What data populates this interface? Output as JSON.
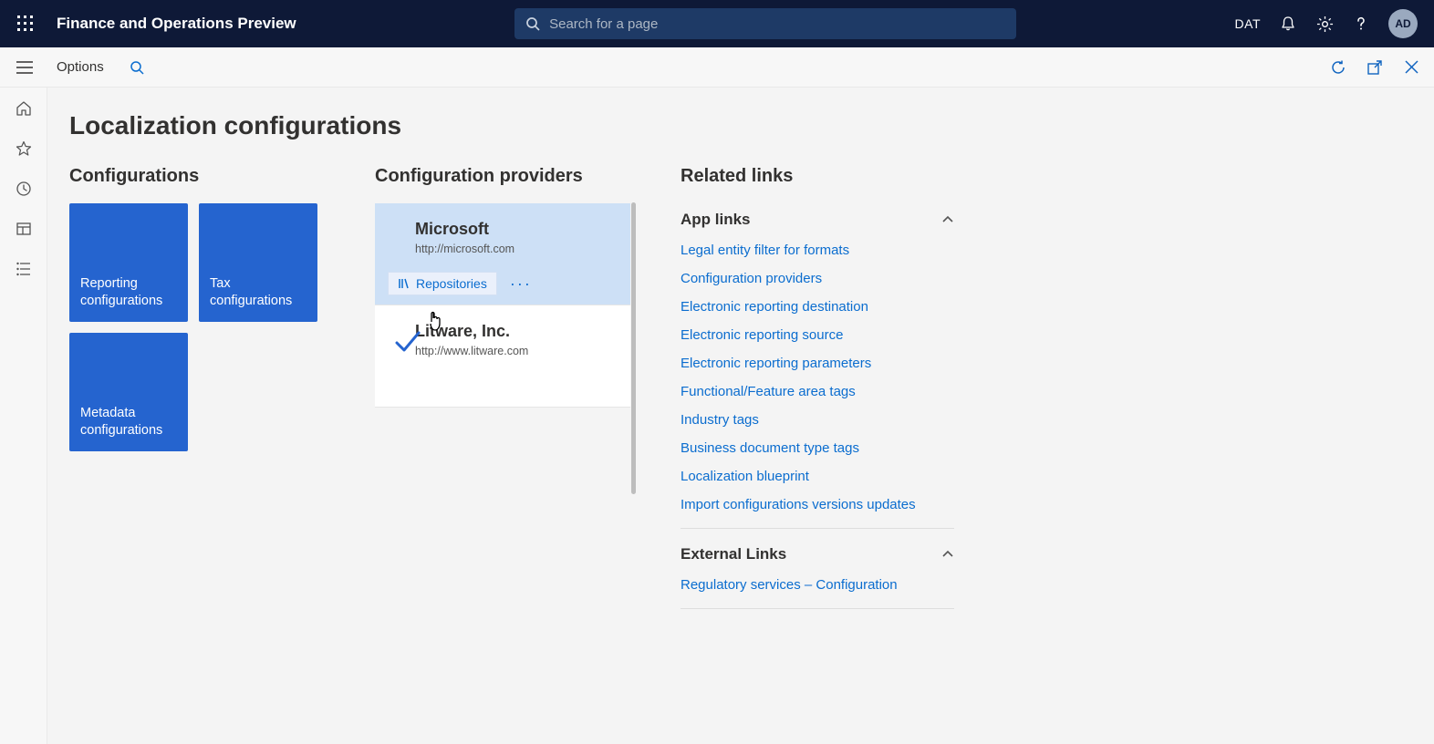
{
  "header": {
    "brand": "Finance and Operations Preview",
    "search_placeholder": "Search for a page",
    "entity_code": "DAT",
    "avatar_initials": "AD"
  },
  "sub_header": {
    "options_label": "Options"
  },
  "page": {
    "title": "Localization configurations"
  },
  "sections": {
    "configurations": "Configurations",
    "providers": "Configuration providers",
    "related": "Related links"
  },
  "tiles": [
    {
      "label": "Reporting configurations"
    },
    {
      "label": "Tax configurations"
    },
    {
      "label": "Metadata configurations"
    }
  ],
  "providers": [
    {
      "name": "Microsoft",
      "url": "http://microsoft.com",
      "active": false,
      "selected": true
    },
    {
      "name": "Litware, Inc.",
      "url": "http://www.litware.com",
      "active": true,
      "selected": false
    }
  ],
  "provider_actions": {
    "repositories": "Repositories"
  },
  "related_links": {
    "app_links_title": "App links",
    "app_links": [
      "Legal entity filter for formats",
      "Configuration providers",
      "Electronic reporting destination",
      "Electronic reporting source",
      "Electronic reporting parameters",
      "Functional/Feature area tags",
      "Industry tags",
      "Business document type tags",
      "Localization blueprint",
      "Import configurations versions updates"
    ],
    "external_links_title": "External Links",
    "external_links": [
      "Regulatory services – Configuration"
    ]
  }
}
